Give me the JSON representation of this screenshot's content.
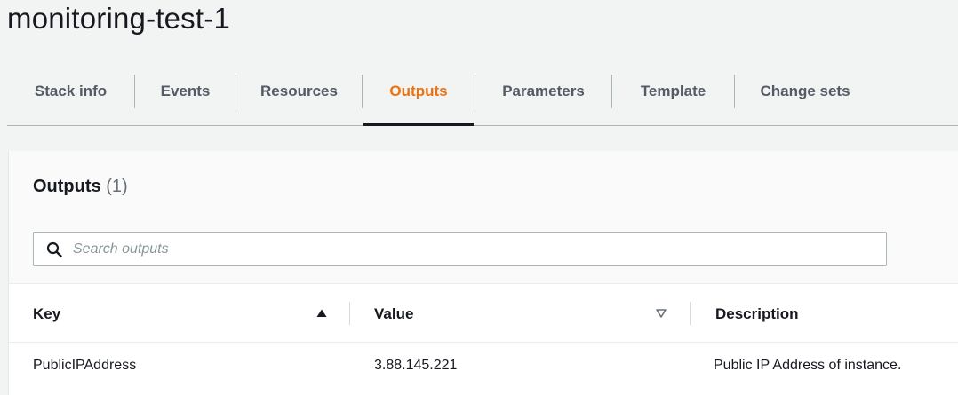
{
  "stack": {
    "title": "monitoring-test-1"
  },
  "tabs": [
    {
      "label": "Stack info",
      "active": false
    },
    {
      "label": "Events",
      "active": false
    },
    {
      "label": "Resources",
      "active": false
    },
    {
      "label": "Outputs",
      "active": true
    },
    {
      "label": "Parameters",
      "active": false
    },
    {
      "label": "Template",
      "active": false
    },
    {
      "label": "Change sets",
      "active": false
    }
  ],
  "outputs": {
    "title": "Outputs",
    "count": "(1)",
    "search": {
      "placeholder": "Search outputs",
      "value": ""
    },
    "columns": [
      {
        "label": "Key",
        "sort": "ascending"
      },
      {
        "label": "Value",
        "sort": "none"
      },
      {
        "label": "Description"
      }
    ],
    "rows": [
      {
        "key": "PublicIPAddress",
        "value": "3.88.145.221",
        "description": "Public IP Address of instance."
      }
    ]
  },
  "colors": {
    "active_tab": "#ec7211",
    "text": "#16191f",
    "muted": "#545b64",
    "background": "#f2f3f3"
  },
  "icons": {
    "search": "search-icon",
    "sort_asc": "caret-up-icon",
    "sort_none": "caret-down-outline-icon"
  }
}
